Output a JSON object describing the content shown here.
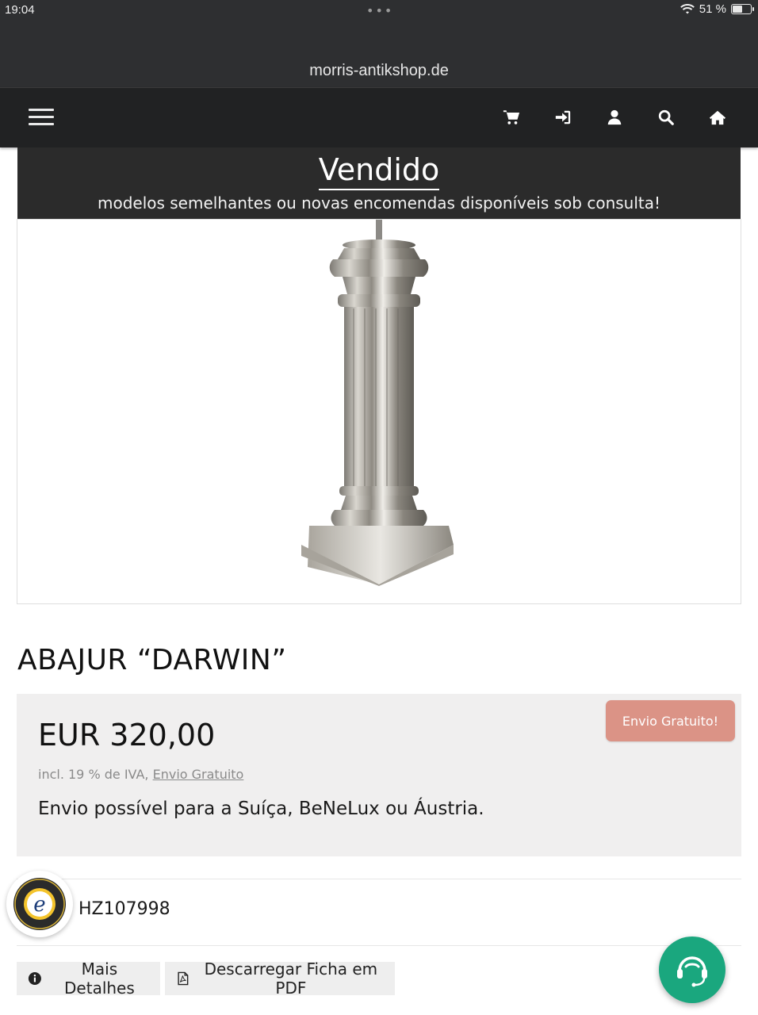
{
  "status_bar": {
    "time": "19:04",
    "battery": "51 %",
    "battery_level": 0.51
  },
  "browser": {
    "url": "morris-antikshop.de"
  },
  "nav": {
    "menu_icon": "hamburger-menu-icon",
    "icons": [
      "cart-icon",
      "sign-in-icon",
      "user-icon",
      "search-icon",
      "home-icon"
    ]
  },
  "banner": {
    "title": "Vendido",
    "subtitle": "modelos semelhantes ou novas encomendas disponíveis sob consulta!"
  },
  "product": {
    "title": "ABAJUR “DARWIN”",
    "price": "EUR 320,00",
    "tax_prefix": "incl. 19 % de IVA,",
    "tax_link": "Envio Gratuito",
    "shipping_note": "Envio possível para a Suíça, BeNeLux ou Áustria.",
    "badge": "Envio Gratuito!",
    "sku": "HZ107998"
  },
  "trust_seal": {
    "icon": "trusted-shops-seal-icon",
    "letter": "e"
  },
  "actions": {
    "details_label": "Mais Detalhes",
    "details_icon": "info-circle-icon",
    "pdf_label": "Descarregar Ficha em PDF",
    "pdf_icon": "pdf-file-icon"
  },
  "chat": {
    "icon": "chat-support-icon"
  },
  "colors": {
    "nav_bg": "#212223",
    "banner_bg": "#2b2b2b",
    "badge_bg": "#db9386",
    "price_box_bg": "#f0efef",
    "chat_bg": "#1aa77e"
  }
}
